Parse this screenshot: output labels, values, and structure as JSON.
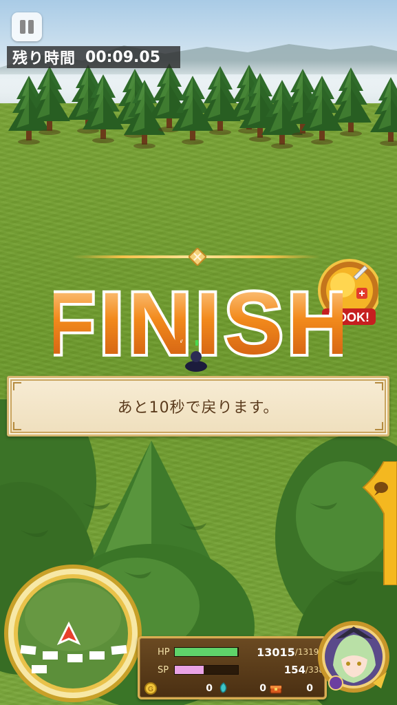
{
  "hud": {
    "timer_label": "残り時間",
    "timer_value": "00:09.05"
  },
  "banner": {
    "finish_text": "FINISH",
    "badge_text": "BOOK!"
  },
  "message": {
    "text": "あと10秒で戻ります。"
  },
  "status": {
    "hp_label": "HP",
    "hp_current": "13015",
    "hp_max": "/13192",
    "hp_ratio": 0.987,
    "sp_label": "SP",
    "sp_current": "154",
    "sp_max": "/338",
    "sp_ratio": 0.456,
    "gold": "0",
    "crystal": "0",
    "chest": "0"
  },
  "colors": {
    "hp_gauge": "#5fd36a",
    "sp_gauge": "#e9a3e6",
    "finish_orange": "#f08a1c",
    "panel_gold": "#d9ad52"
  },
  "icons": [
    "pause-icon",
    "book-badge-icon",
    "gold-coin-icon",
    "crystal-icon",
    "treasure-chest-icon",
    "compass-arrow-icon",
    "chat-tab-icon"
  ]
}
